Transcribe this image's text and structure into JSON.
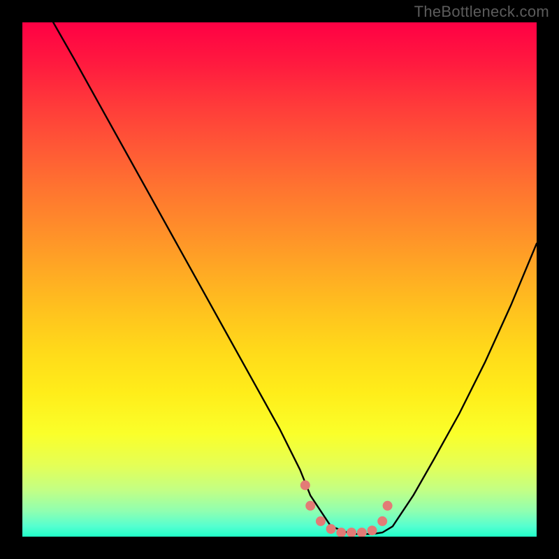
{
  "watermark": "TheBottleneck.com",
  "colors": {
    "page_bg": "#000000",
    "watermark": "#5c5c5c",
    "curve": "#000000",
    "marker": "#e37b76"
  },
  "chart_data": {
    "type": "line",
    "title": "",
    "xlabel": "",
    "ylabel": "",
    "xlim": [
      0,
      100
    ],
    "ylim": [
      0,
      100
    ],
    "grid": false,
    "legend": false,
    "note": "No axis ticks or numeric labels are visible; values below are normalized 0–100 estimates read from the plot geometry.",
    "series": [
      {
        "name": "curve",
        "x": [
          6,
          10,
          15,
          20,
          25,
          30,
          35,
          40,
          45,
          50,
          54,
          56,
          60,
          64,
          68,
          70,
          72,
          76,
          80,
          85,
          90,
          95,
          100
        ],
        "y": [
          100,
          93,
          84,
          75,
          66,
          57,
          48,
          39,
          30,
          21,
          13,
          8,
          2,
          0.5,
          0.5,
          0.8,
          2,
          8,
          15,
          24,
          34,
          45,
          57
        ]
      }
    ],
    "valley_markers": {
      "name": "valley-highlight",
      "x": [
        55,
        56,
        58,
        60,
        62,
        64,
        66,
        68,
        70,
        71
      ],
      "y": [
        10,
        6,
        3,
        1.5,
        0.8,
        0.8,
        0.8,
        1.2,
        3,
        6
      ]
    }
  }
}
